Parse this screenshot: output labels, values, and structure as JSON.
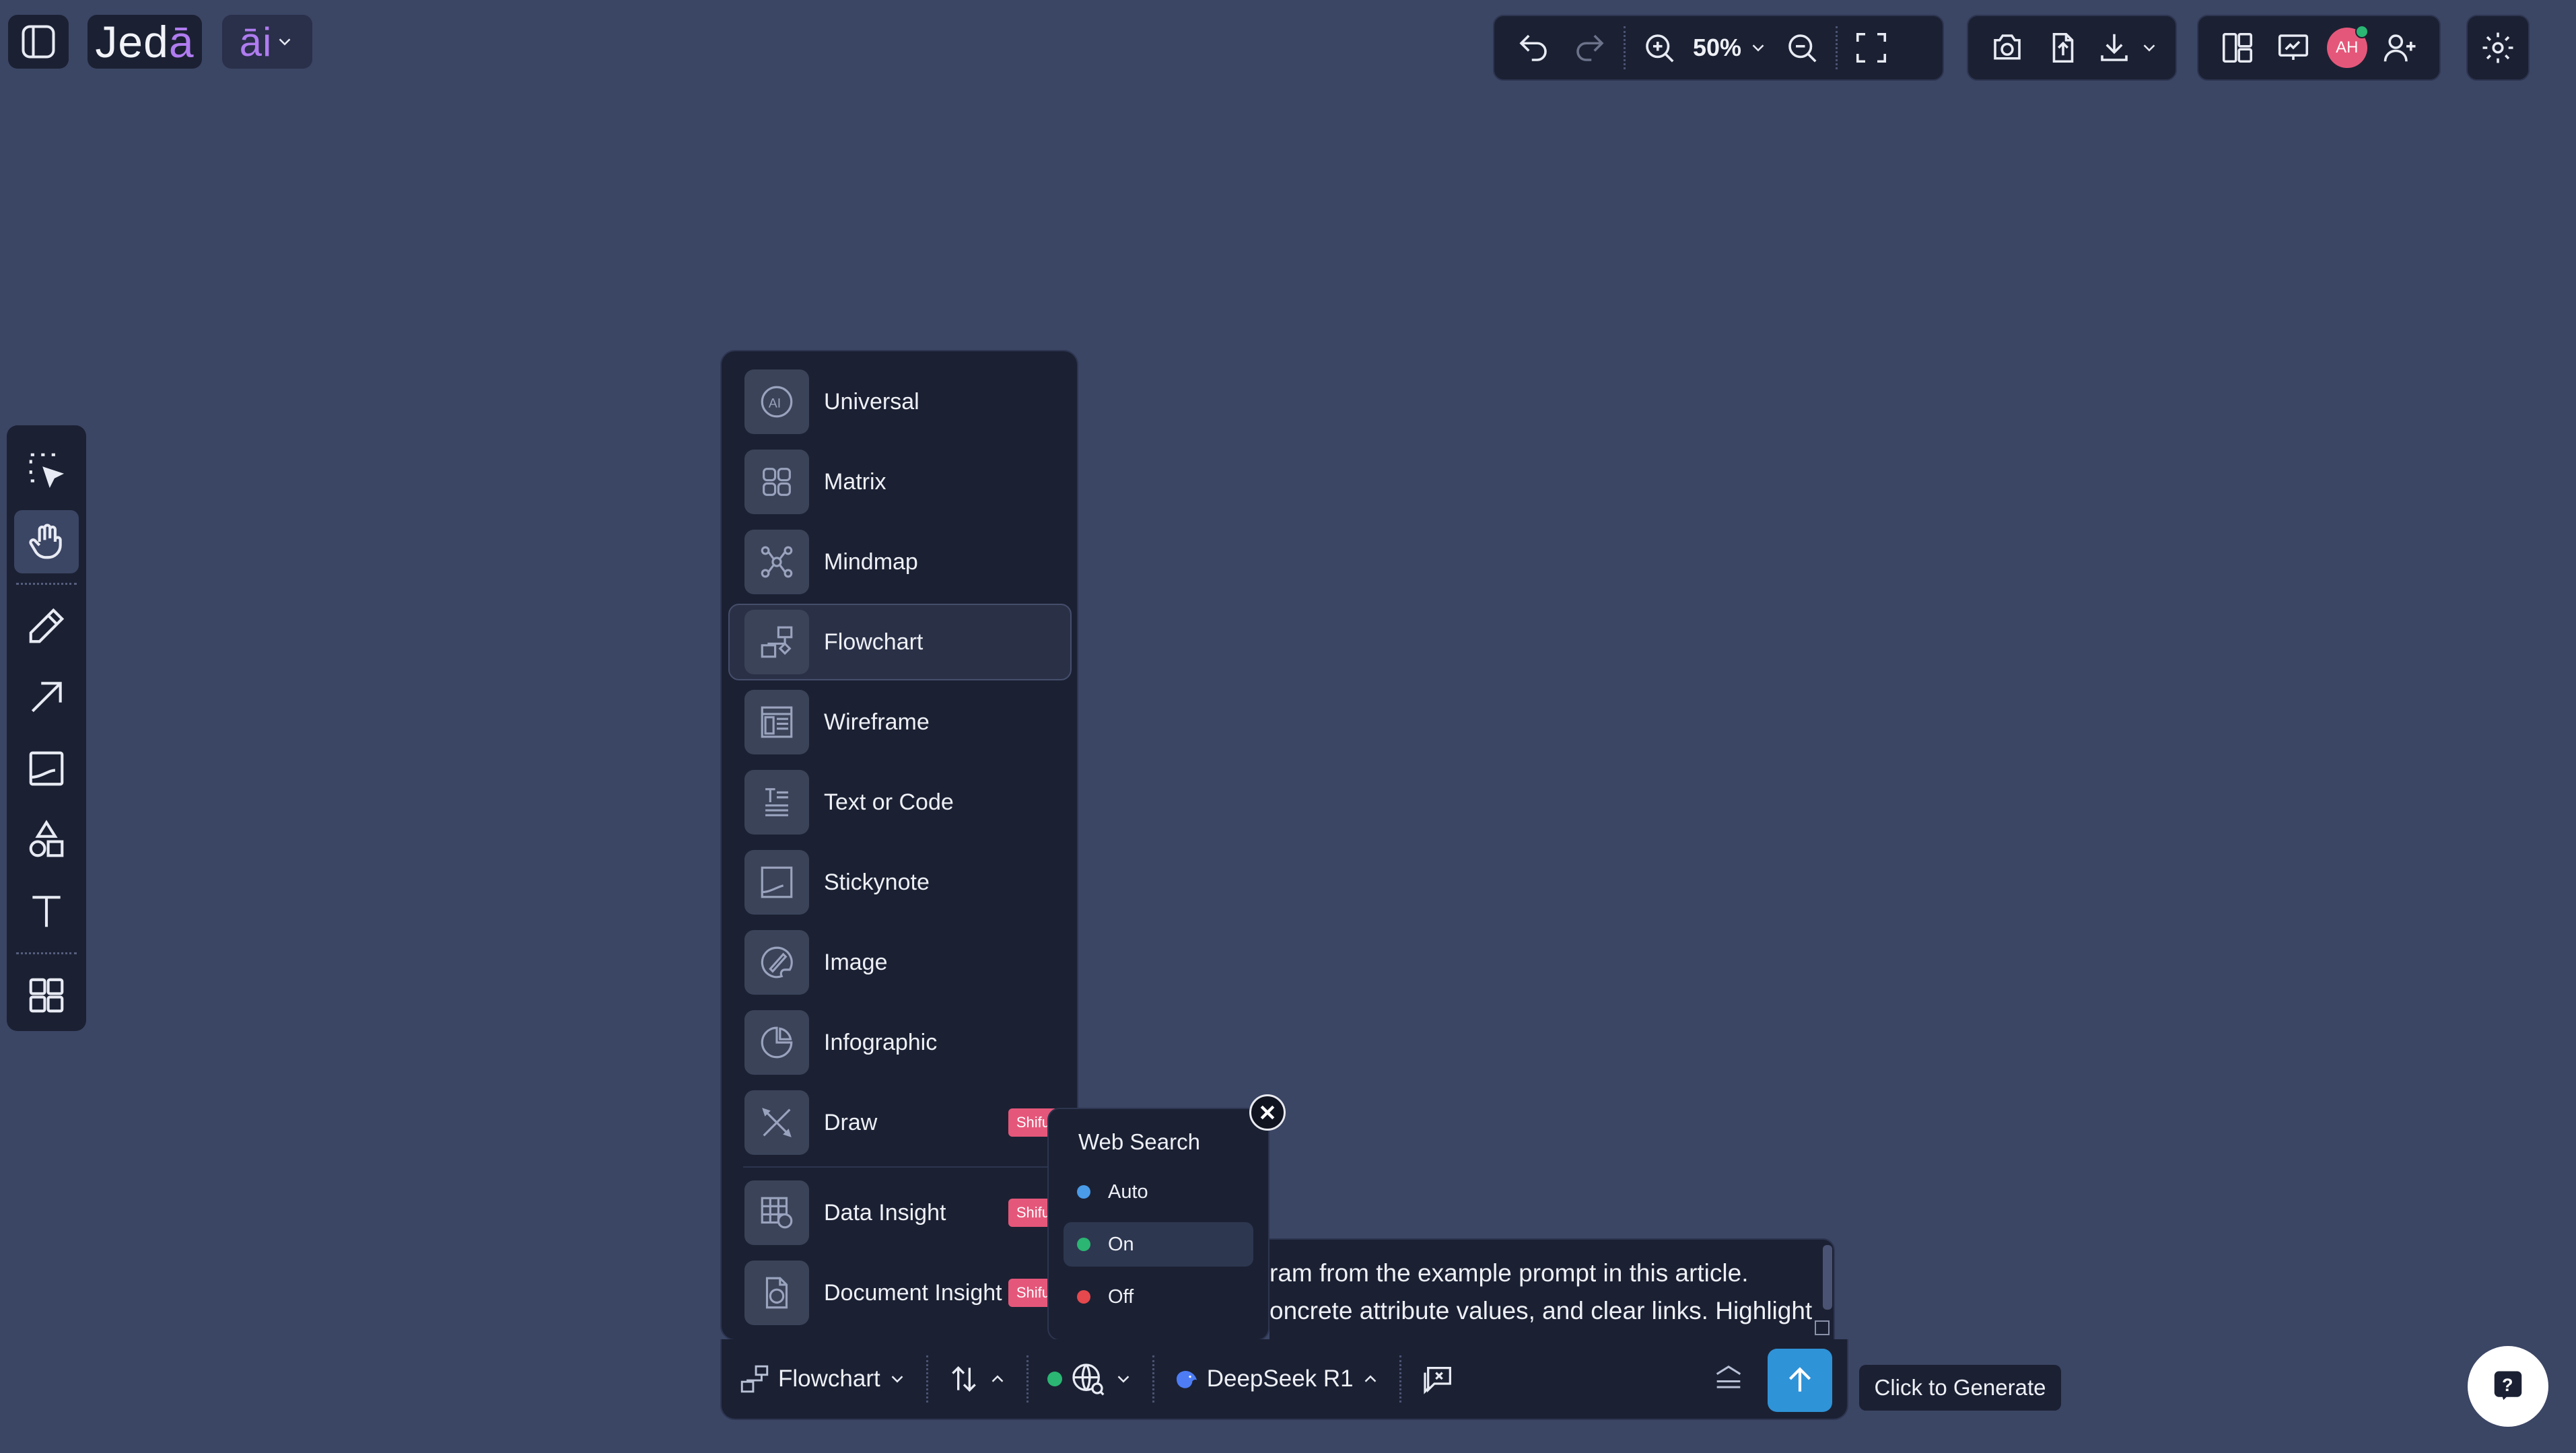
{
  "app": {
    "logo_text": "Jed",
    "logo_accent": "ā",
    "ai_label": "āi"
  },
  "toolbar": {
    "zoom_level": "50%"
  },
  "user": {
    "avatar_initials": "AH"
  },
  "type_menu": {
    "items": [
      {
        "label": "Universal",
        "icon": "ai-circle-icon"
      },
      {
        "label": "Matrix",
        "icon": "matrix-grid-icon"
      },
      {
        "label": "Mindmap",
        "icon": "mindmap-icon"
      },
      {
        "label": "Flowchart",
        "icon": "flowchart-icon",
        "active": true
      },
      {
        "label": "Wireframe",
        "icon": "wireframe-icon"
      },
      {
        "label": "Text or Code",
        "icon": "text-code-icon"
      },
      {
        "label": "Stickynote",
        "icon": "stickynote-icon"
      },
      {
        "label": "Image",
        "icon": "image-brush-icon"
      },
      {
        "label": "Infographic",
        "icon": "infographic-icon"
      },
      {
        "label": "Draw",
        "icon": "draw-pencils-icon",
        "badge": "Shifu"
      },
      {
        "label": "Data Insight",
        "icon": "data-insight-icon",
        "badge": "Shifu"
      },
      {
        "label": "Document Insight",
        "icon": "document-insight-icon",
        "badge": "Shifu"
      }
    ]
  },
  "web_search": {
    "title": "Web Search",
    "options": [
      {
        "label": "Auto",
        "color": "#4a9be8"
      },
      {
        "label": "On",
        "color": "#2bb673",
        "selected": true
      },
      {
        "label": "Off",
        "color": "#e5484d"
      }
    ]
  },
  "prompt": {
    "line1": "ram from the example prompt in this article.",
    "line2": "oncrete attribute values, and clear links. Highlight"
  },
  "bottom_bar": {
    "diagram_type": "Flowchart",
    "model": "DeepSeek R1",
    "web_status_color": "#2bb673"
  },
  "generate": {
    "tooltip": "Click to Generate"
  }
}
